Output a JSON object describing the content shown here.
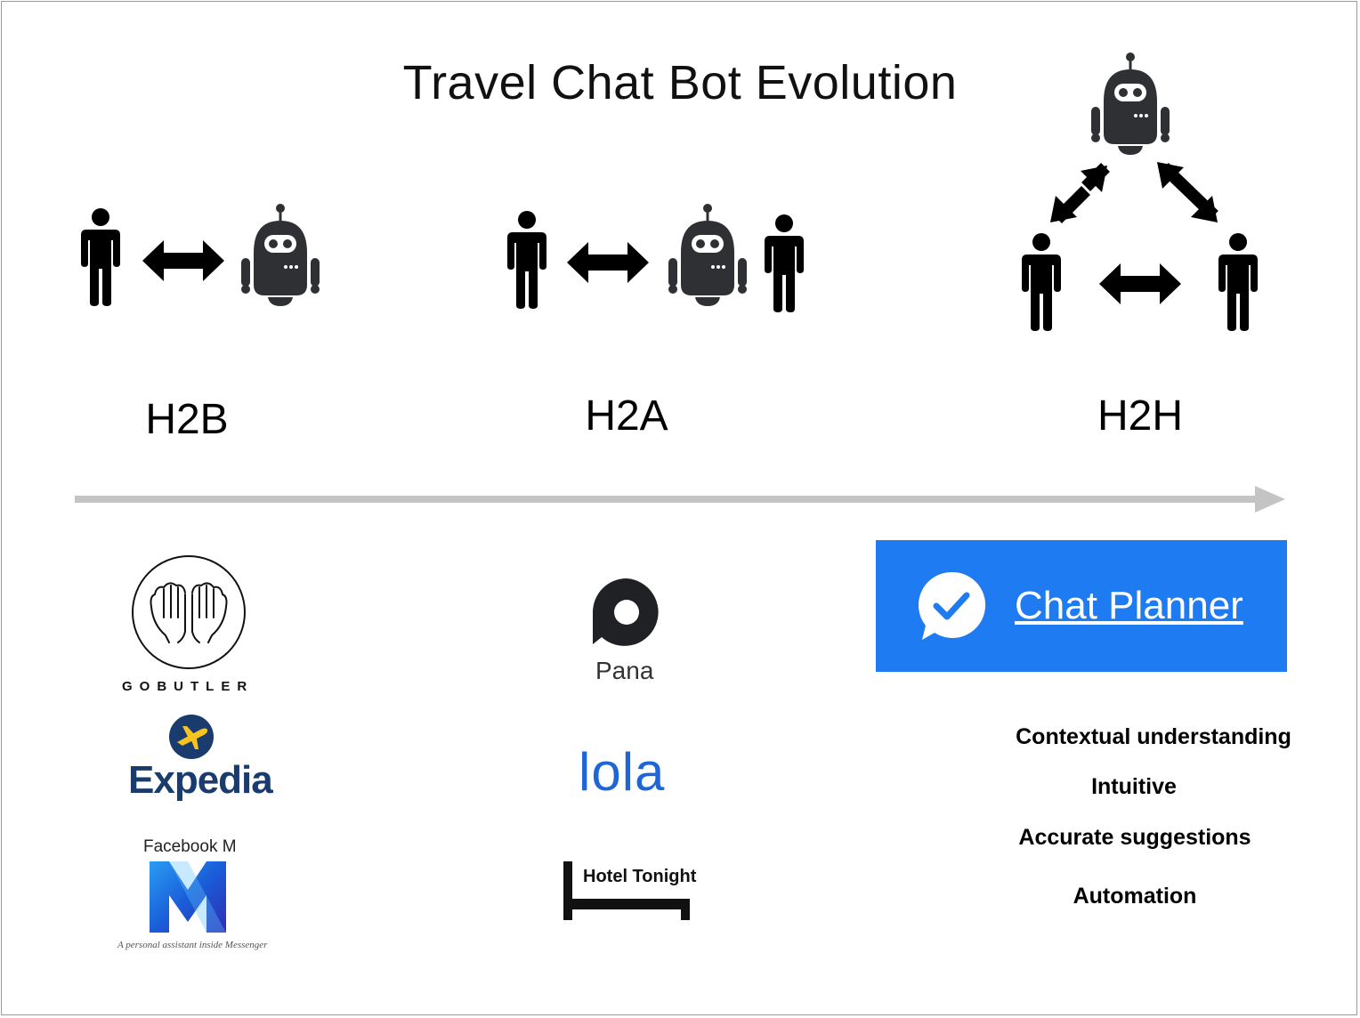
{
  "title": "Travel Chat Bot Evolution",
  "stages": [
    {
      "label": "H2B"
    },
    {
      "label": "H2A"
    },
    {
      "label": "H2H"
    }
  ],
  "logos": {
    "gobutler": "GOBUTLER",
    "expedia": "Expedia",
    "facebook_m": "Facebook M",
    "facebook_m_tagline": "A personal assistant inside Messenger",
    "pana": "Pana",
    "lola": "lola",
    "hotel_tonight": "Hotel Tonight",
    "chat_planner": "Chat Planner"
  },
  "features": [
    "Contextual understanding",
    "Intuitive",
    "Accurate suggestions",
    "Automation"
  ],
  "colors": {
    "icon_dark": "#2e3033",
    "arrow_gray": "#c4c4c4",
    "chat_planner_blue": "#1f7bf2",
    "expedia_navy": "#1a3b6e",
    "expedia_yellow": "#f7c41f",
    "lola_blue": "#1e66d8",
    "fbm_blue": "#1a6fe0"
  }
}
